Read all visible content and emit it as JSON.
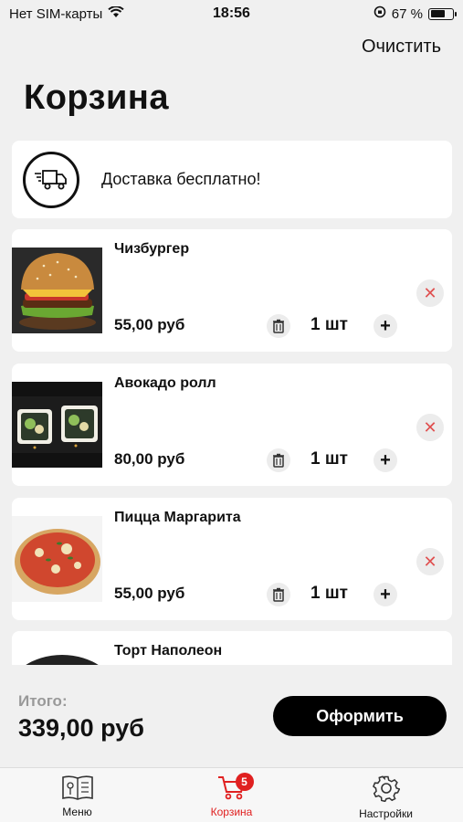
{
  "status_bar": {
    "carrier": "Нет SIM-карты",
    "time": "18:56",
    "battery": "67 %",
    "battery_level": 0.67
  },
  "header": {
    "clear_label": "Очистить",
    "title": "Корзина"
  },
  "delivery": {
    "text": "Доставка бесплатно!",
    "icon": "delivery-truck-icon"
  },
  "items": [
    {
      "name": "Чизбургер",
      "price": "55,00 руб",
      "qty": "1 шт",
      "image": "burger"
    },
    {
      "name": "Авокадо ролл",
      "price": "80,00 руб",
      "qty": "1 шт",
      "image": "rolls"
    },
    {
      "name": "Пицца Маргарита",
      "price": "55,00 руб",
      "qty": "1 шт",
      "image": "pizza"
    },
    {
      "name": "Торт Наполеон",
      "image": "cake"
    }
  ],
  "footer": {
    "total_label": "Итого:",
    "total_value": "339,00 руб",
    "checkout_label": "Оформить"
  },
  "tabs": [
    {
      "label": "Меню",
      "icon": "menu-book-icon",
      "active": false
    },
    {
      "label": "Корзина",
      "icon": "cart-icon",
      "active": true,
      "badge": "5"
    },
    {
      "label": "Настройки",
      "icon": "gear-icon",
      "active": false
    }
  ],
  "colors": {
    "accent": "#e02020",
    "background": "#f0f0f0",
    "card": "#ffffff",
    "button": "#000000"
  }
}
